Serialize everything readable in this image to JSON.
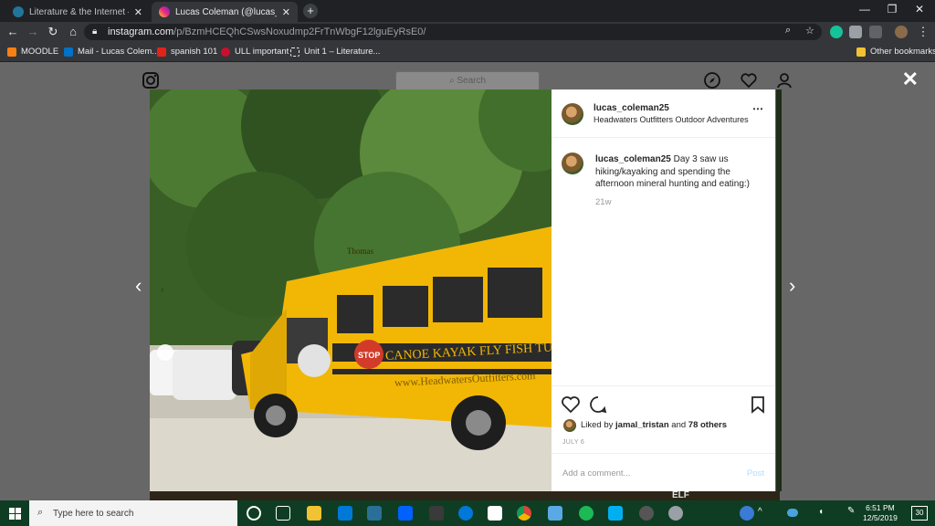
{
  "browser": {
    "tabs": [
      {
        "title": "Literature & the Internet — Wor",
        "favicon": "wordpress-icon",
        "active": false
      },
      {
        "title": "Lucas Coleman (@lucas_colemar",
        "favicon": "instagram-icon",
        "active": true
      }
    ],
    "url": {
      "host": "instagram.com",
      "path": "/p/BzmHCEQhCSwsNoxudmp2FrTnWbgF12lguEyRsE0/"
    },
    "bookmarks": [
      {
        "label": "MOODLE",
        "icon": "moodle-icon",
        "color": "#f98012"
      },
      {
        "label": "Mail - Lucas Colem...",
        "icon": "outlook-icon",
        "color": "#0072c6"
      },
      {
        "label": "spanish 101",
        "icon": "acrobat-icon",
        "color": "#e2231a"
      },
      {
        "label": "ULL important",
        "icon": "ull-icon",
        "color": "#c8102e"
      },
      {
        "label": "Unit 1 – Literature...",
        "icon": "page-icon",
        "color": "#e8eaed"
      }
    ],
    "other_bookmarks": "Other bookmarks"
  },
  "instagram": {
    "search_placeholder": "Search",
    "post": {
      "username": "lucas_coleman25",
      "location": "Headwaters Outfitters Outdoor Adventures",
      "caption": "Day 3 saw us hiking/kayaking and spending the afternoon mineral hunting and eating:)",
      "age": "21w",
      "liked_by_prefix": "Liked by",
      "liked_by_user": "jamal_tristan",
      "liked_and": "and",
      "likes_others": "78 others",
      "date": "JULY 6",
      "comment_placeholder": "Add a comment...",
      "post_button": "Post"
    },
    "photo": {
      "bus_side_text": "CANOE  KAYAK  FLY FISH  TUB",
      "bus_url": "www.HeadwatersOutfitters.com",
      "stop_sign": "STOP",
      "bus_brand": "Thomas"
    },
    "below_text": "ELF"
  },
  "taskbar": {
    "search_placeholder": "Type here to search",
    "time": "6:51 PM",
    "date": "12/5/2019",
    "notification_count": "30"
  },
  "colors": {
    "chrome_dark": "#202124",
    "chrome_toolbar": "#35363a",
    "taskbar": "#0f3d23",
    "bus_yellow": "#f2b705"
  }
}
